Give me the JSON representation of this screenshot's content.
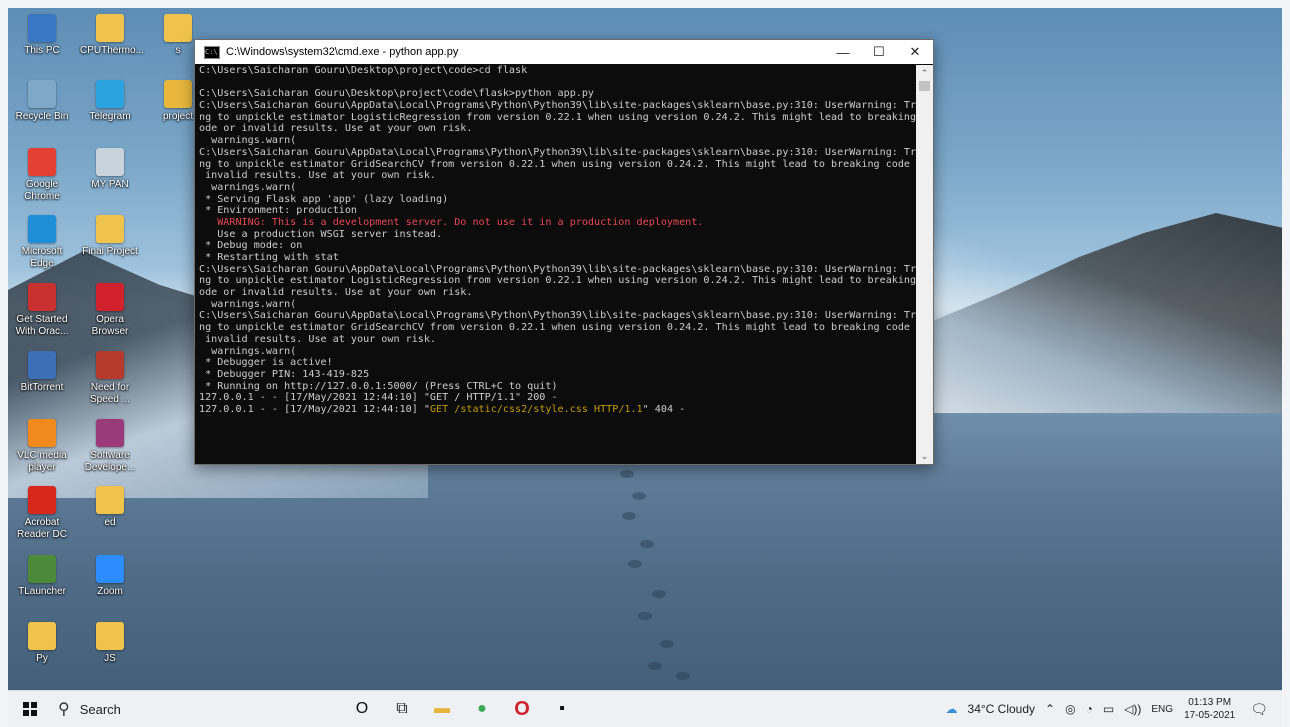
{
  "desktop": {
    "icons": [
      {
        "id": "this-pc",
        "label": "This PC",
        "color": "#3b78c4"
      },
      {
        "id": "cputhermo",
        "label": "CPUThermo...",
        "color": "#f0c44c"
      },
      {
        "id": "s",
        "label": "s",
        "color": "#f0c44c"
      },
      {
        "id": "recycle-bin",
        "label": "Recycle Bin",
        "color": "#7fa7c8"
      },
      {
        "id": "telegram",
        "label": "Telegram",
        "color": "#2aa3df"
      },
      {
        "id": "project",
        "label": "project",
        "color": "#e9b73c"
      },
      {
        "id": "google-chrome",
        "label": "Google Chrome",
        "color": "#e44134"
      },
      {
        "id": "my-pan",
        "label": "MY PAN",
        "color": "#c9d3dc"
      },
      {
        "id": "microsoft-edge",
        "label": "Microsoft Edge",
        "color": "#1e8fd6"
      },
      {
        "id": "final-project",
        "label": "Final Project",
        "color": "#f0c44c"
      },
      {
        "id": "get-started-oracle",
        "label": "Get Started With Orac...",
        "color": "#c8312f"
      },
      {
        "id": "opera",
        "label": "Opera Browser",
        "color": "#d1212d"
      },
      {
        "id": "bittorrent",
        "label": "BitTorrent",
        "color": "#3d6fb7"
      },
      {
        "id": "need-for-speed",
        "label": "Need for Speed ...",
        "color": "#b73a2e"
      },
      {
        "id": "vlc",
        "label": "VLC media player",
        "color": "#f08a1c"
      },
      {
        "id": "software-developer",
        "label": "Software Develope...",
        "color": "#9a3a7a"
      },
      {
        "id": "acrobat",
        "label": "Acrobat Reader DC",
        "color": "#d8271c"
      },
      {
        "id": "ed",
        "label": "ed",
        "color": "#f0c44c"
      },
      {
        "id": "tlauncher",
        "label": "TLauncher",
        "color": "#4c8a3a"
      },
      {
        "id": "zoom",
        "label": "Zoom",
        "color": "#2d8cff"
      },
      {
        "id": "py",
        "label": "Py",
        "color": "#f0c44c"
      },
      {
        "id": "js",
        "label": "JS",
        "color": "#f0c44c"
      }
    ]
  },
  "cmd": {
    "title": "C:\\Windows\\system32\\cmd.exe - python  app.py",
    "icon_text": "C:\\",
    "controls": {
      "minimize": "—",
      "maximize": "☐",
      "close": "✕"
    },
    "lines": [
      {
        "text": "C:\\Users\\Saicharan Gouru\\Desktop\\project\\code>cd flask"
      },
      {
        "text": ""
      },
      {
        "text": "C:\\Users\\Saicharan Gouru\\Desktop\\project\\code\\flask>python app.py"
      },
      {
        "text": "C:\\Users\\Saicharan Gouru\\AppData\\Local\\Programs\\Python\\Python39\\lib\\site-packages\\sklearn\\base.py:310: UserWarning: Tryi"
      },
      {
        "text": "ng to unpickle estimator LogisticRegression from version 0.22.1 when using version 0.24.2. This might lead to breaking c"
      },
      {
        "text": "ode or invalid results. Use at your own risk."
      },
      {
        "text": "  warnings.warn("
      },
      {
        "text": "C:\\Users\\Saicharan Gouru\\AppData\\Local\\Programs\\Python\\Python39\\lib\\site-packages\\sklearn\\base.py:310: UserWarning: Tryi"
      },
      {
        "text": "ng to unpickle estimator GridSearchCV from version 0.22.1 when using version 0.24.2. This might lead to breaking code or"
      },
      {
        "text": " invalid results. Use at your own risk."
      },
      {
        "text": "  warnings.warn("
      },
      {
        "text": " * Serving Flask app 'app' (lazy loading)"
      },
      {
        "text": " * Environment: production"
      },
      {
        "text": "   WARNING: This is a development server. Do not use it in a production deployment.",
        "color": "red"
      },
      {
        "text": "   Use a production WSGI server instead."
      },
      {
        "text": " * Debug mode: on"
      },
      {
        "text": " * Restarting with stat"
      },
      {
        "text": "C:\\Users\\Saicharan Gouru\\AppData\\Local\\Programs\\Python\\Python39\\lib\\site-packages\\sklearn\\base.py:310: UserWarning: Tryi"
      },
      {
        "text": "ng to unpickle estimator LogisticRegression from version 0.22.1 when using version 0.24.2. This might lead to breaking c"
      },
      {
        "text": "ode or invalid results. Use at your own risk."
      },
      {
        "text": "  warnings.warn("
      },
      {
        "text": "C:\\Users\\Saicharan Gouru\\AppData\\Local\\Programs\\Python\\Python39\\lib\\site-packages\\sklearn\\base.py:310: UserWarning: Tryi"
      },
      {
        "text": "ng to unpickle estimator GridSearchCV from version 0.22.1 when using version 0.24.2. This might lead to breaking code or"
      },
      {
        "text": " invalid results. Use at your own risk."
      },
      {
        "text": "  warnings.warn("
      },
      {
        "text": " * Debugger is active!"
      },
      {
        "text": " * Debugger PIN: 143-419-825"
      },
      {
        "text": " * Running on http://127.0.0.1:5000/ (Press CTRL+C to quit)"
      },
      {
        "text": "127.0.0.1 - - [17/May/2021 12:44:10] \"GET / HTTP/1.1\" 200 -"
      },
      {
        "pre": "127.0.0.1 - - [17/May/2021 12:44:10] \"",
        "hl": "GET /static/css2/style.css HTTP/1.1",
        "post": "\" 404 -"
      }
    ]
  },
  "taskbar": {
    "search_label": "Search",
    "pinned": [
      {
        "id": "cortana",
        "glyph": "O"
      },
      {
        "id": "task-view",
        "glyph": "⧉"
      },
      {
        "id": "file-explorer",
        "glyph": "▬"
      },
      {
        "id": "chrome",
        "glyph": "●"
      },
      {
        "id": "opera",
        "glyph": "O"
      },
      {
        "id": "cmd",
        "glyph": "▪"
      }
    ],
    "weather": "34°C  Cloudy",
    "language": "ENG",
    "time": "01:13 PM",
    "date": "17-05-2021"
  }
}
